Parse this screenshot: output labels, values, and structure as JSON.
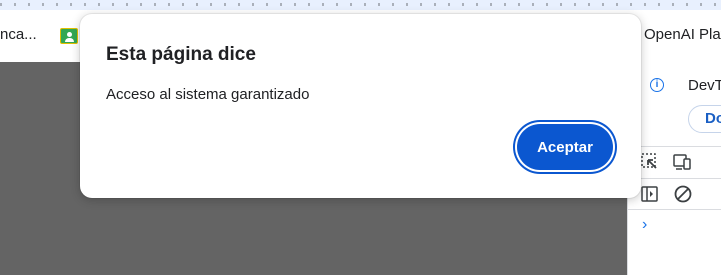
{
  "bookmarks": {
    "left_item_label": "nca...",
    "right_item_label": "OpenAI Plat"
  },
  "dialog": {
    "title": "Esta página dice",
    "message": "Acceso al sistema garantizado",
    "ok_label": "Aceptar"
  },
  "devtools": {
    "title": "DevT",
    "button_label": "Do"
  },
  "colors": {
    "page_background": "#646464",
    "accent": "#0b57d0",
    "devtools_link": "#1a73e8"
  }
}
